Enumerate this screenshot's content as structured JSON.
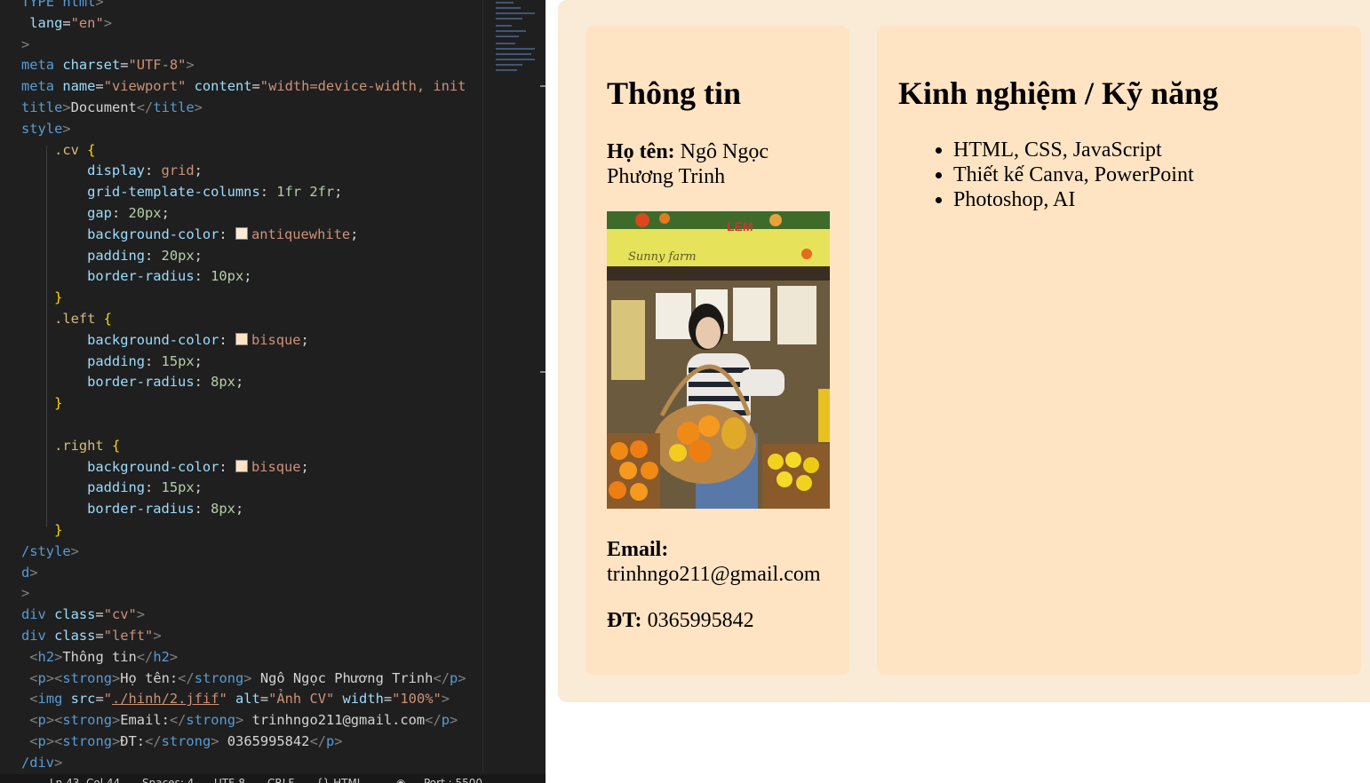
{
  "editor": {
    "lines": [
      [
        [
          "tag",
          "TYPE html"
        ],
        [
          "br",
          ">"
        ]
      ],
      [
        [
          "text",
          " "
        ],
        [
          "attr",
          "lang"
        ],
        [
          "text",
          "="
        ],
        [
          "str",
          "\"en\""
        ],
        [
          "br",
          ">"
        ]
      ],
      [
        [
          "br",
          ">"
        ]
      ],
      [
        [
          "tag",
          "meta "
        ],
        [
          "attr",
          "charset"
        ],
        [
          "text",
          "="
        ],
        [
          "str",
          "\"UTF-8\""
        ],
        [
          "br",
          ">"
        ]
      ],
      [
        [
          "tag",
          "meta "
        ],
        [
          "attr",
          "name"
        ],
        [
          "text",
          "="
        ],
        [
          "str",
          "\"viewport\" "
        ],
        [
          "attr",
          "content"
        ],
        [
          "text",
          "="
        ],
        [
          "str",
          "\"width=device-width, init"
        ]
      ],
      [
        [
          "tag",
          "title"
        ],
        [
          "br",
          ">"
        ],
        [
          "text",
          "Document"
        ],
        [
          "br",
          "</"
        ],
        [
          "tag",
          "title"
        ],
        [
          "br",
          ">"
        ]
      ],
      [
        [
          "tag",
          "style"
        ],
        [
          "br",
          ">"
        ]
      ],
      [
        [
          "sel",
          "    .cv "
        ],
        [
          "brace",
          "{"
        ]
      ],
      [
        [
          "prop",
          "        display"
        ],
        [
          "text",
          ": "
        ],
        [
          "val",
          "grid"
        ],
        [
          "text",
          ";"
        ]
      ],
      [
        [
          "prop",
          "        grid-template-columns"
        ],
        [
          "text",
          ": "
        ],
        [
          "num",
          "1fr 2fr"
        ],
        [
          "text",
          ";"
        ]
      ],
      [
        [
          "prop",
          "        gap"
        ],
        [
          "text",
          ": "
        ],
        [
          "num",
          "20px"
        ],
        [
          "text",
          ";"
        ]
      ],
      [
        [
          "prop",
          "        background-color"
        ],
        [
          "text",
          ": "
        ],
        [
          "swatch",
          "#faebd7"
        ],
        [
          "val",
          "antiquewhite"
        ],
        [
          "text",
          ";"
        ]
      ],
      [
        [
          "prop",
          "        padding"
        ],
        [
          "text",
          ": "
        ],
        [
          "num",
          "20px"
        ],
        [
          "text",
          ";"
        ]
      ],
      [
        [
          "prop",
          "        border-radius"
        ],
        [
          "text",
          ": "
        ],
        [
          "num",
          "10px"
        ],
        [
          "text",
          ";"
        ]
      ],
      [
        [
          "brace",
          "    }"
        ]
      ],
      [
        [
          "sel",
          "    .left "
        ],
        [
          "brace",
          "{"
        ]
      ],
      [
        [
          "prop",
          "        background-color"
        ],
        [
          "text",
          ": "
        ],
        [
          "swatch",
          "#ffe4c4"
        ],
        [
          "val",
          "bisque"
        ],
        [
          "text",
          ";"
        ]
      ],
      [
        [
          "prop",
          "        padding"
        ],
        [
          "text",
          ": "
        ],
        [
          "num",
          "15px"
        ],
        [
          "text",
          ";"
        ]
      ],
      [
        [
          "prop",
          "        border-radius"
        ],
        [
          "text",
          ": "
        ],
        [
          "num",
          "8px"
        ],
        [
          "text",
          ";"
        ]
      ],
      [
        [
          "brace",
          "    }"
        ]
      ],
      [
        [
          "text",
          ""
        ]
      ],
      [
        [
          "sel",
          "    .right "
        ],
        [
          "brace",
          "{"
        ]
      ],
      [
        [
          "prop",
          "        background-color"
        ],
        [
          "text",
          ": "
        ],
        [
          "swatch",
          "#ffe4c4"
        ],
        [
          "val",
          "bisque"
        ],
        [
          "text",
          ";"
        ]
      ],
      [
        [
          "prop",
          "        padding"
        ],
        [
          "text",
          ": "
        ],
        [
          "num",
          "15px"
        ],
        [
          "text",
          ";"
        ]
      ],
      [
        [
          "prop",
          "        border-radius"
        ],
        [
          "text",
          ": "
        ],
        [
          "num",
          "8px"
        ],
        [
          "text",
          ";"
        ]
      ],
      [
        [
          "brace",
          "    }"
        ]
      ],
      [
        [
          "tag",
          "/style"
        ],
        [
          "br",
          ">"
        ]
      ],
      [
        [
          "tag",
          "d"
        ],
        [
          "br",
          ">"
        ]
      ],
      [
        [
          "br",
          ">"
        ]
      ],
      [
        [
          "tag",
          "div "
        ],
        [
          "attr",
          "class"
        ],
        [
          "text",
          "="
        ],
        [
          "str",
          "\"cv\""
        ],
        [
          "br",
          ">"
        ]
      ],
      [
        [
          "tag",
          "div "
        ],
        [
          "attr",
          "class"
        ],
        [
          "text",
          "="
        ],
        [
          "str",
          "\"left\""
        ],
        [
          "br",
          ">"
        ]
      ],
      [
        [
          "br",
          " <"
        ],
        [
          "tag",
          "h2"
        ],
        [
          "br",
          ">"
        ],
        [
          "text",
          "Thông tin"
        ],
        [
          "br",
          "</"
        ],
        [
          "tag",
          "h2"
        ],
        [
          "br",
          ">"
        ]
      ],
      [
        [
          "br",
          " <"
        ],
        [
          "tag",
          "p"
        ],
        [
          "br",
          "><"
        ],
        [
          "tag",
          "strong"
        ],
        [
          "br",
          ">"
        ],
        [
          "text",
          "Họ tên:"
        ],
        [
          "br",
          "</"
        ],
        [
          "tag",
          "strong"
        ],
        [
          "br",
          ">"
        ],
        [
          "text",
          " Ngô Ngọc Phương Trinh"
        ],
        [
          "br",
          "</"
        ],
        [
          "tag",
          "p"
        ],
        [
          "br",
          ">"
        ]
      ],
      [
        [
          "br",
          " <"
        ],
        [
          "tag",
          "img "
        ],
        [
          "attr",
          "src"
        ],
        [
          "text",
          "="
        ],
        [
          "str",
          "\""
        ],
        [
          "link",
          "./hinh/2.jfif"
        ],
        [
          "str",
          "\" "
        ],
        [
          "attr",
          "alt"
        ],
        [
          "text",
          "="
        ],
        [
          "str",
          "\"Ảnh CV\" "
        ],
        [
          "attr",
          "width"
        ],
        [
          "text",
          "="
        ],
        [
          "str",
          "\"100%\""
        ],
        [
          "br",
          ">"
        ]
      ],
      [
        [
          "br",
          " <"
        ],
        [
          "tag",
          "p"
        ],
        [
          "br",
          "><"
        ],
        [
          "tag",
          "strong"
        ],
        [
          "br",
          ">"
        ],
        [
          "text",
          "Email:"
        ],
        [
          "br",
          "</"
        ],
        [
          "tag",
          "strong"
        ],
        [
          "br",
          ">"
        ],
        [
          "text",
          " trinhngo211@gmail.com"
        ],
        [
          "br",
          "</"
        ],
        [
          "tag",
          "p"
        ],
        [
          "br",
          ">"
        ]
      ],
      [
        [
          "br",
          " <"
        ],
        [
          "tag",
          "p"
        ],
        [
          "br",
          "><"
        ],
        [
          "tag",
          "strong"
        ],
        [
          "br",
          ">"
        ],
        [
          "text",
          "ĐT:"
        ],
        [
          "br",
          "</"
        ],
        [
          "tag",
          "strong"
        ],
        [
          "br",
          ">"
        ],
        [
          "text",
          " 0365995842"
        ],
        [
          "br",
          "</"
        ],
        [
          "tag",
          "p"
        ],
        [
          "br",
          ">"
        ]
      ],
      [
        [
          "tag",
          "/div"
        ],
        [
          "br",
          ">"
        ]
      ]
    ],
    "status": {
      "position": "Ln 43, Col 44",
      "spaces": "Spaces: 4",
      "encoding": "UTF-8",
      "eol": "CRLF",
      "language": "{} HTML",
      "port": "Port : 5500"
    }
  },
  "preview": {
    "left_heading": "Thông tin",
    "name_label": "Họ tên:",
    "name_value": " Ngô Ngọc Phương Trinh",
    "email_label": "Email:",
    "email_value": "trinhngo211@gmail.com",
    "phone_label": "ĐT:",
    "phone_value": " 0365995842",
    "right_heading": "Kinh nghiệm / Kỹ năng",
    "skills": [
      "HTML, CSS, JavaScript",
      "Thiết kế Canva, PowerPoint",
      "Photoshop, AI"
    ],
    "photo_sign_text": "LEM",
    "photo_script_text": "Sunny farm"
  },
  "colors": {
    "cv_bg": "#faebd7",
    "panel_bg": "#ffe4c4",
    "editor_bg": "#1f1f1f"
  }
}
